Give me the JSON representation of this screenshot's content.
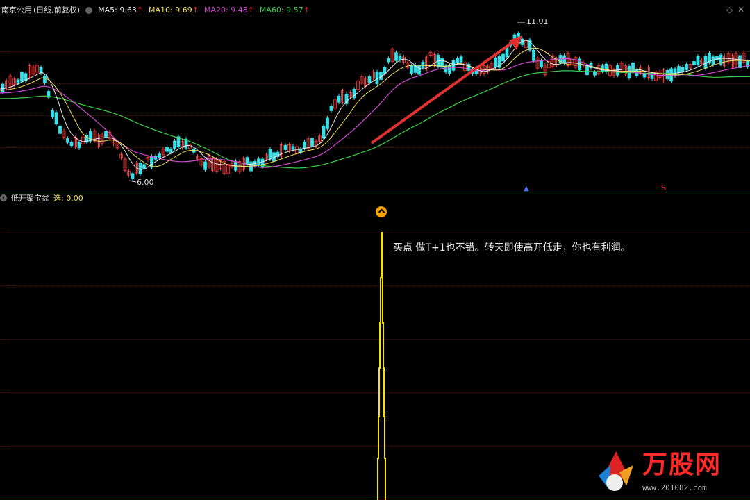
{
  "header": {
    "stock_name": "南京公用",
    "period": "(日线,前复权)",
    "ma5_label": "MA5:",
    "ma5_value": "9.63",
    "ma10_label": "MA10:",
    "ma10_value": "9.69",
    "ma20_label": "MA20:",
    "ma20_value": "9.48",
    "ma60_label": "MA60:",
    "ma60_value": "9.57",
    "arrow": "↑"
  },
  "price_chart": {
    "high_label": "11.01",
    "low_label": "6.00",
    "marker_buy": "▲",
    "marker_s": "S",
    "colors": {
      "bull": "#ff3b3b",
      "bear": "#35e0e8",
      "ma5": "#e8e8e8",
      "ma10": "#f1e05a",
      "ma20": "#d14cd2",
      "ma60": "#3ed04a",
      "arrow": "#e03030"
    }
  },
  "indicator": {
    "name": "低开聚宝盆",
    "value_label": "选:",
    "value": "0.00",
    "signal_color": "#f5e400",
    "note": "买点  做T+1也不错。转天即使高开低走，你也有利润。"
  },
  "watermark": {
    "brand": "万股网",
    "url": "www.201082.com"
  }
}
